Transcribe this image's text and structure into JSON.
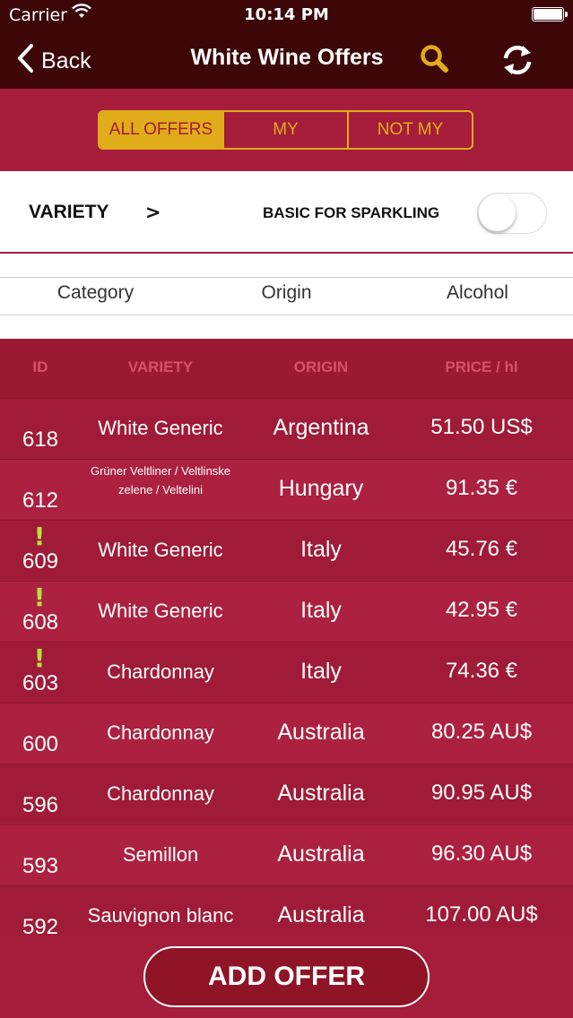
{
  "status_bar": {
    "carrier": "Carrier",
    "time": "10:14 PM"
  },
  "nav": {
    "back_label": "Back",
    "title": "White Wine Offers"
  },
  "segments": [
    {
      "label": "ALL OFFERS",
      "active": true
    },
    {
      "label": "MY",
      "active": false
    },
    {
      "label": "NOT MY",
      "active": false
    }
  ],
  "filter": {
    "variety_label": "VARIETY",
    "variety_chevron": ">",
    "sparkling_label": "BASIC FOR SPARKLING",
    "sparkling_on": false
  },
  "sort": [
    "Category",
    "Origin",
    "Alcohol"
  ],
  "table": {
    "headers": [
      "ID",
      "VARIETY",
      "ORIGIN",
      "PRICE / hl"
    ],
    "rows": [
      {
        "id": "618",
        "variety": "White Generic",
        "origin": "Argentina",
        "price": "51.50 US$",
        "flag": false
      },
      {
        "id": "612",
        "variety": "Grüner Veltliner / Veltlinske zelene / Veltelini",
        "origin": "Hungary",
        "price": "91.35 €",
        "flag": false
      },
      {
        "id": "609",
        "variety": "White Generic",
        "origin": "Italy",
        "price": "45.76 €",
        "flag": true
      },
      {
        "id": "608",
        "variety": "White Generic",
        "origin": "Italy",
        "price": "42.95 €",
        "flag": true
      },
      {
        "id": "603",
        "variety": "Chardonnay",
        "origin": "Italy",
        "price": "74.36 €",
        "flag": true
      },
      {
        "id": "600",
        "variety": "Chardonnay",
        "origin": "Australia",
        "price": "80.25 AU$",
        "flag": false
      },
      {
        "id": "596",
        "variety": "Chardonnay",
        "origin": "Australia",
        "price": "90.95 AU$",
        "flag": false
      },
      {
        "id": "593",
        "variety": "Semillon",
        "origin": "Australia",
        "price": "96.30 AU$",
        "flag": false
      },
      {
        "id": "592",
        "variety": "Sauvignon blanc",
        "origin": "Australia",
        "price": "107.00 AU$",
        "flag": false
      }
    ],
    "flag_symbol": "!"
  },
  "add_button_label": "ADD OFFER",
  "colors": {
    "brand": "#a51d3a",
    "nav": "#3d0708",
    "accent": "#e0ac1a",
    "flag": "#b6e23d"
  }
}
